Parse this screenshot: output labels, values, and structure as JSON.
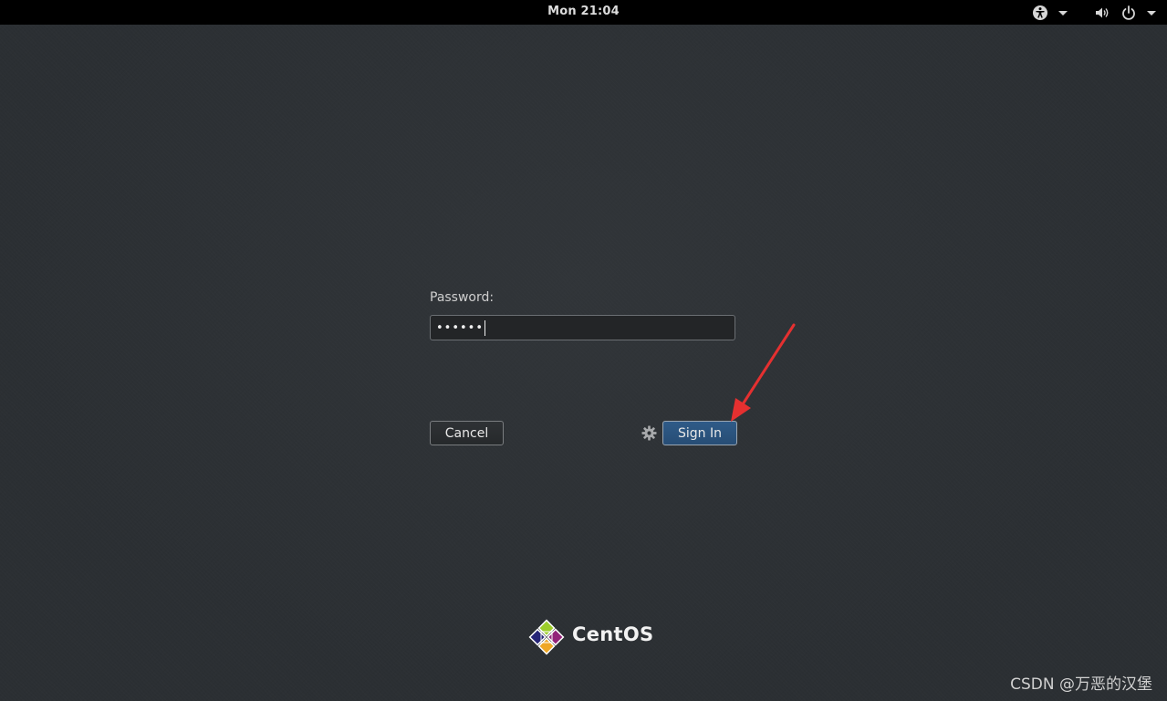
{
  "topbar": {
    "clock": "Mon 21:04",
    "icons": [
      "accessibility-icon",
      "volume-icon",
      "power-icon"
    ]
  },
  "login": {
    "password_label": "Password:",
    "password_value": "••••••",
    "cancel_label": "Cancel",
    "signin_label": "Sign In",
    "settings_icon": "gear-icon"
  },
  "logo": {
    "text": "CentOS"
  },
  "watermark": {
    "text": "CSDN @万恶的汉堡"
  },
  "colors": {
    "background": "#2b2f33",
    "topbar": "#000000",
    "signin_button": "#2c5582",
    "annotation_arrow": "#e53030"
  }
}
